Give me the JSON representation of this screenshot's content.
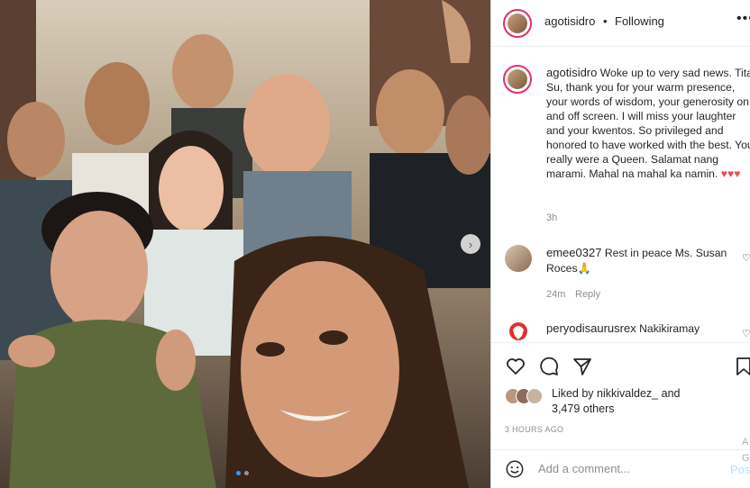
{
  "post": {
    "author": "agotisidro",
    "follow_status": "Following",
    "separator": "•",
    "caption_text": "Woke up to very sad news. Tita Su, thank you for your warm presence, your words of wisdom, your generosity on and off screen. I will miss your laughter and your kwentos. So privileged and honored to have worked with the best. You really were a Queen. Salamat nang marami. Mahal na mahal ka namin.",
    "caption_hearts": "♥♥♥",
    "caption_age": "3h"
  },
  "comments": [
    {
      "username": "emee0327",
      "text": "Rest in peace Ms. Susan Roces🙏",
      "age": "24m",
      "reply_label": "Reply"
    },
    {
      "username": "peryodisaurusrex",
      "text": "Nakikiramay"
    }
  ],
  "likes": {
    "prefix": "Liked by",
    "user": "nikkivaldez_",
    "connector": "and",
    "others": "3,479 others"
  },
  "timestamp": "3 HOURS AGO",
  "comment_box": {
    "placeholder": "Add a comment...",
    "post_label": "Post"
  },
  "watermark": {
    "line1": "A",
    "line2": "G"
  },
  "icons": [
    "more-icon",
    "heart-icon",
    "comment-icon",
    "share-icon",
    "bookmark-icon",
    "emoji-icon",
    "carousel-next-icon",
    "praying-hands-emoji",
    "heart-emoji"
  ],
  "colors": {
    "accent_blue": "#3897f0",
    "heart_red": "#ed4956",
    "post_disabled": "#b2dffc",
    "story_ring": "#e1306c"
  },
  "carousel": {
    "current": 1,
    "total": 2
  }
}
